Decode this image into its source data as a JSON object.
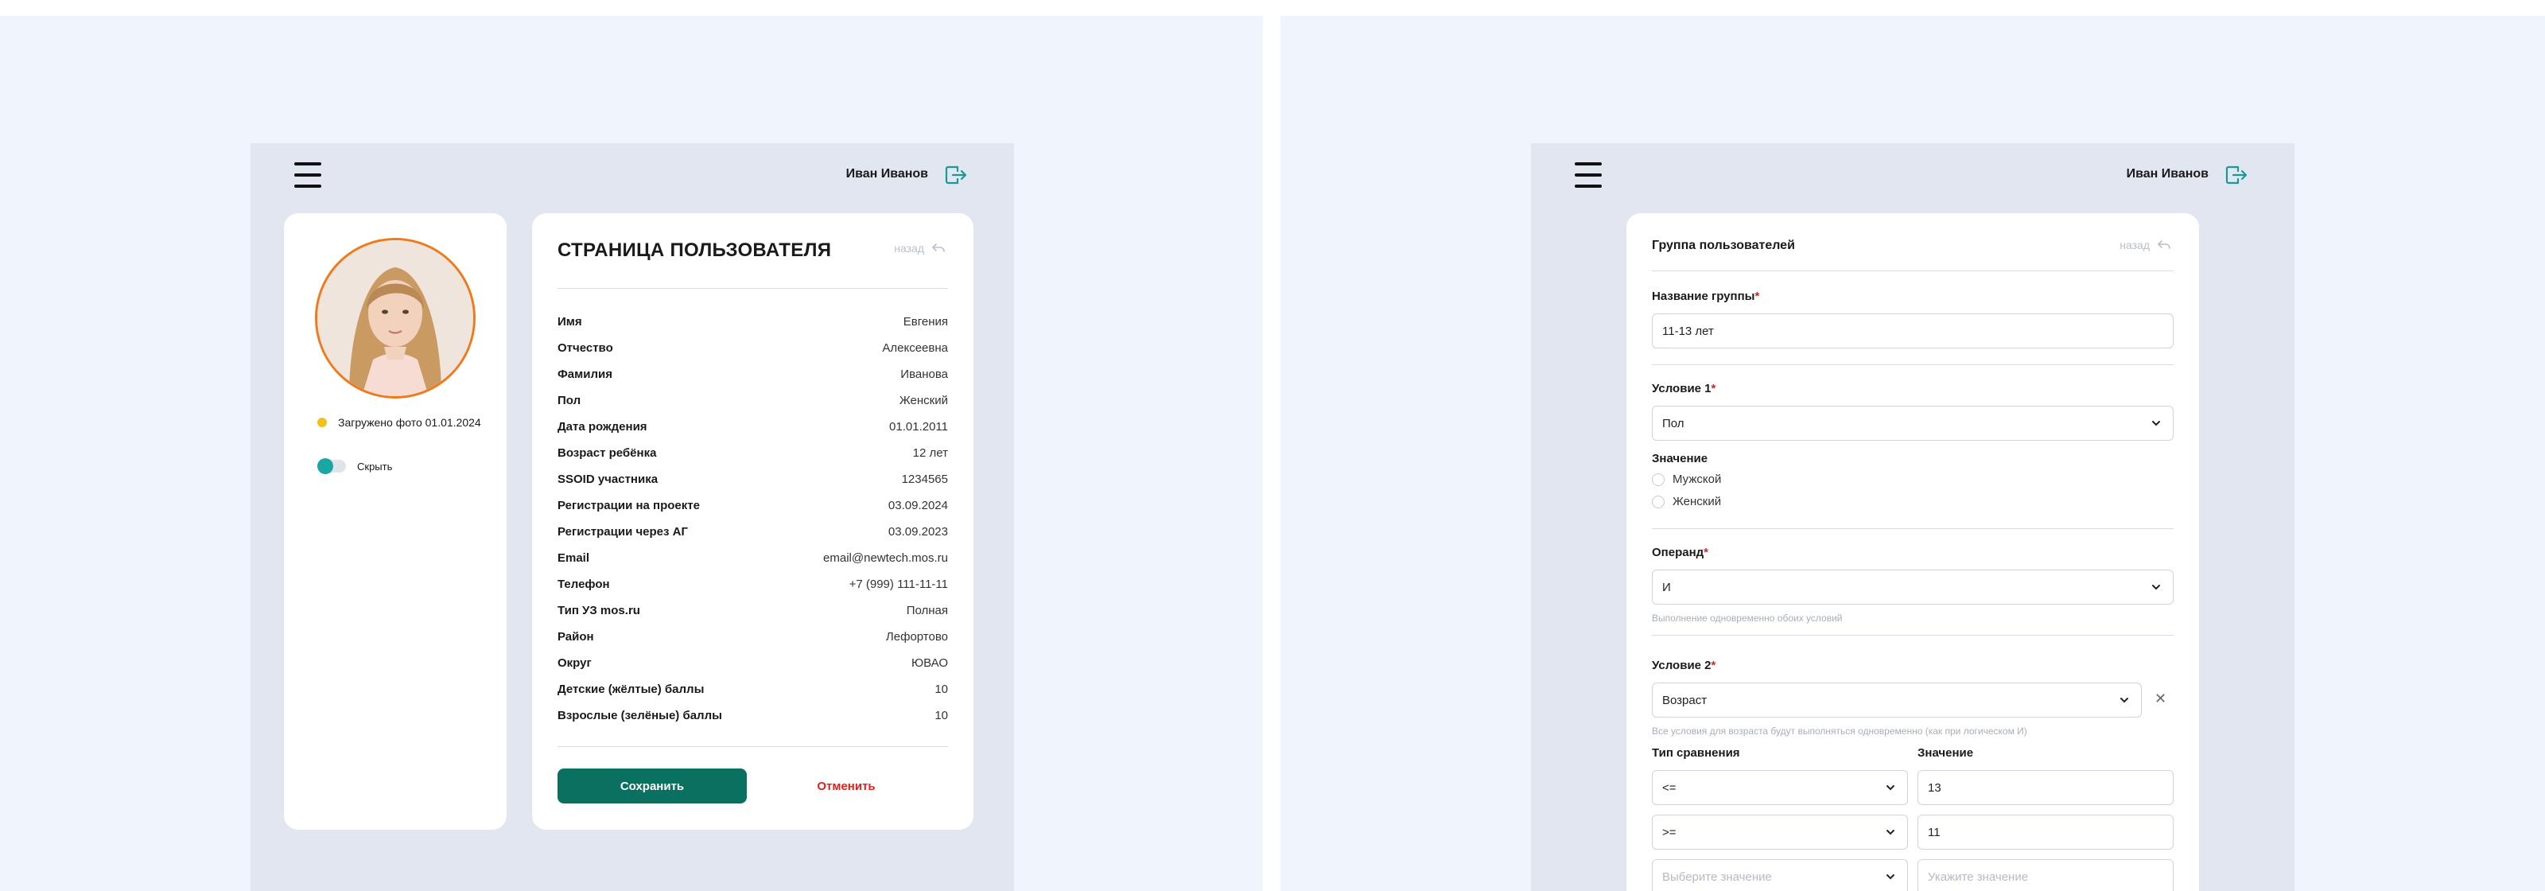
{
  "header": {
    "user_name": "Иван Иванов"
  },
  "profile": {
    "photo_status": "Загружено фото 01.01.2024",
    "hide_label": "Скрыть",
    "title": "СТРАНИЦА ПОЛЬЗОВАТЕЛЯ",
    "back_label": "назад",
    "fields": [
      {
        "label": "Имя",
        "value": "Евгения"
      },
      {
        "label": "Отчество",
        "value": "Алексеевна"
      },
      {
        "label": "Фамилия",
        "value": "Иванова"
      },
      {
        "label": "Пол",
        "value": "Женский"
      },
      {
        "label": "Дата рождения",
        "value": "01.01.2011"
      },
      {
        "label": "Возраст ребёнка",
        "value": "12 лет"
      },
      {
        "label": "SSOID участника",
        "value": "1234565"
      },
      {
        "label": "Регистрации на проекте",
        "value": "03.09.2024"
      },
      {
        "label": "Регистрации через АГ",
        "value": "03.09.2023"
      },
      {
        "label": "Email",
        "value": "email@newtech.mos.ru"
      },
      {
        "label": "Телефон",
        "value": "+7 (999) 111-11-11"
      },
      {
        "label": "Тип УЗ mos.ru",
        "value": "Полная"
      },
      {
        "label": "Район",
        "value": "Лефортово"
      },
      {
        "label": "Округ",
        "value": "ЮВАО"
      },
      {
        "label": "Детские (жёлтые) баллы",
        "value": "10"
      },
      {
        "label": "Взрослые (зелёные) баллы",
        "value": "10"
      }
    ],
    "save_label": "Сохранить",
    "cancel_label": "Отменить"
  },
  "group": {
    "title": "Группа пользователей",
    "back_label": "назад",
    "name_label": "Название группы",
    "name_value": "11-13 лет",
    "condition1_label": "Условие 1",
    "condition1_value": "Пол",
    "value_label": "Значение",
    "radio_options": [
      "Мужской",
      "Женский"
    ],
    "operand_label": "Операнд",
    "operand_value": "И",
    "operand_hint": "Выполнение одновременно обоих условий",
    "condition2_label": "Условие 2",
    "condition2_value": "Возраст",
    "condition2_hint": "Все условия для возраста будут выполняться одновременно (как при логическом И)",
    "comparison_label": "Тип сравнения",
    "comparison_value_label": "Значение",
    "comparisons": [
      {
        "op": "<=",
        "value": "13"
      },
      {
        "op": ">=",
        "value": "11"
      }
    ],
    "placeholder_op": "Выберите значение",
    "placeholder_value": "Укажите значение",
    "required_mark": "*"
  }
}
